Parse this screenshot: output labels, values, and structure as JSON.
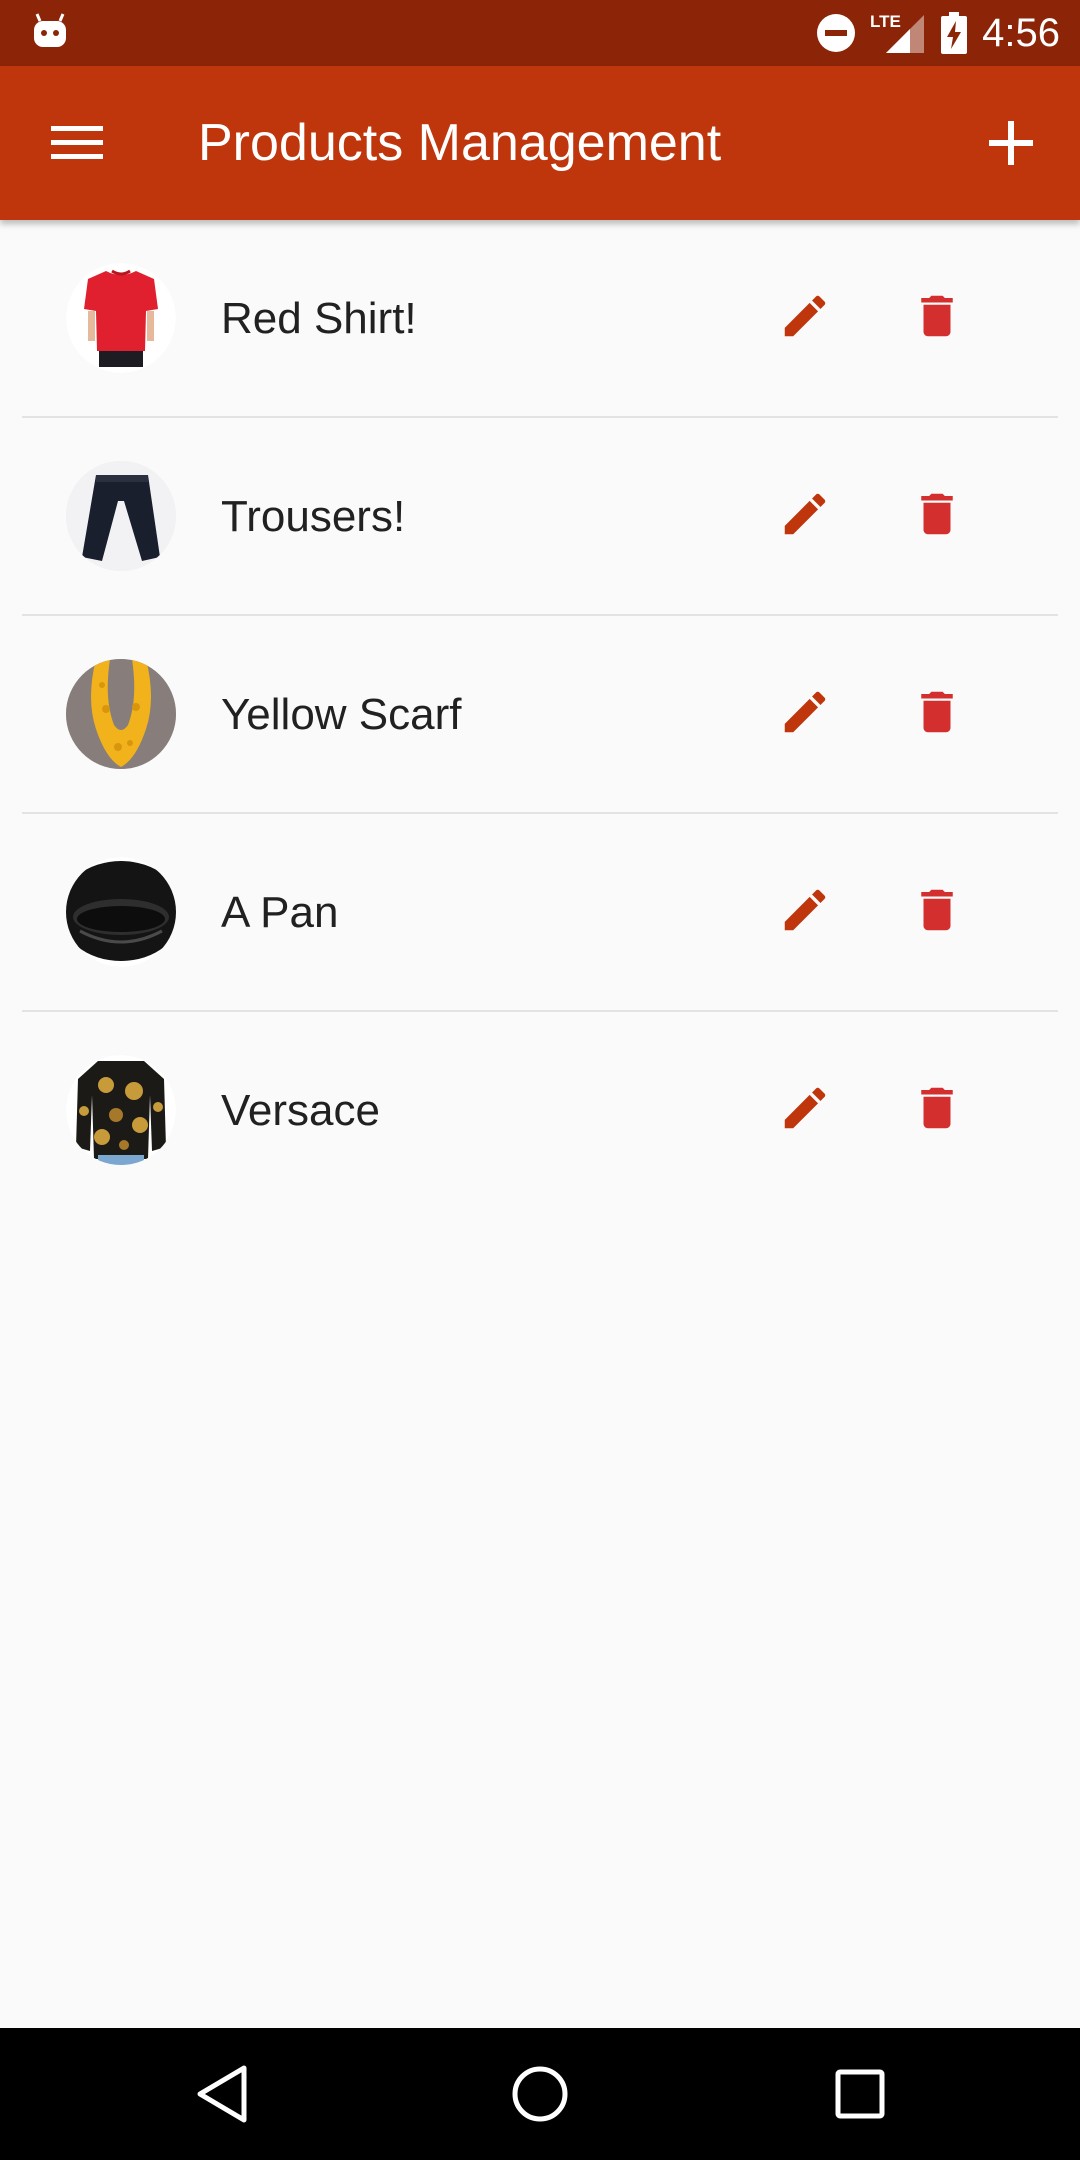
{
  "status_bar": {
    "time": "4:56",
    "network_label": "LTE",
    "icons": [
      "android-debug-icon",
      "do-not-disturb-icon",
      "lte-signal-icon",
      "battery-charging-icon"
    ]
  },
  "app_bar": {
    "title": "Products Management",
    "menu_icon": "hamburger-menu-icon",
    "add_icon": "add-icon"
  },
  "colors": {
    "status_bar": "#8c2507",
    "app_bar": "#bf360c",
    "edit_icon": "#bf360c",
    "delete_icon": "#d32f2f",
    "background": "#fafafa",
    "text": "#212121"
  },
  "products": [
    {
      "name": "Red Shirt!",
      "thumbnail": "red-shirt-thumbnail"
    },
    {
      "name": "Trousers!",
      "thumbnail": "trousers-thumbnail"
    },
    {
      "name": "Yellow Scarf",
      "thumbnail": "yellow-scarf-thumbnail"
    },
    {
      "name": "A Pan",
      "thumbnail": "pan-thumbnail"
    },
    {
      "name": "Versace",
      "thumbnail": "versace-jacket-thumbnail"
    }
  ],
  "row_actions": {
    "edit_icon": "pencil-icon",
    "delete_icon": "trash-icon"
  },
  "nav_bar": {
    "icons": [
      "back-icon",
      "home-icon",
      "recents-icon"
    ]
  }
}
